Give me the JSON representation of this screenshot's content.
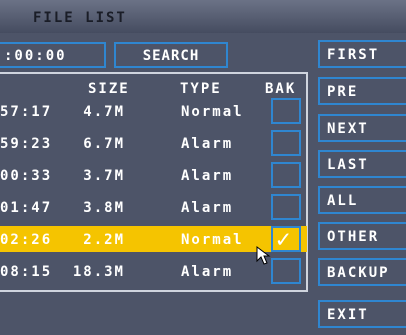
{
  "window": {
    "title": "FILE LIST"
  },
  "search": {
    "time_value": ":00:00",
    "button_label": "SEARCH"
  },
  "table": {
    "headers": {
      "size": "SIZE",
      "type": "TYPE",
      "bak": "BAK"
    },
    "rows": [
      {
        "time": "57:17",
        "size": "4.7M",
        "type": "Normal",
        "bak_checked": false,
        "selected": false
      },
      {
        "time": "59:23",
        "size": "6.7M",
        "type": "Alarm",
        "bak_checked": false,
        "selected": false
      },
      {
        "time": "00:33",
        "size": "3.7M",
        "type": "Alarm",
        "bak_checked": false,
        "selected": false
      },
      {
        "time": "01:47",
        "size": "3.8M",
        "type": "Alarm",
        "bak_checked": false,
        "selected": false
      },
      {
        "time": "02:26",
        "size": "2.2M",
        "type": "Normal",
        "bak_checked": true,
        "selected": true
      },
      {
        "time": "08:15",
        "size": "18.3M",
        "type": "Alarm",
        "bak_checked": false,
        "selected": false
      }
    ],
    "check_glyph": "✓"
  },
  "side_buttons": [
    "FIRST",
    "PRE",
    "NEXT",
    "LAST",
    "ALL",
    "OTHER",
    "BACKUP",
    "EXIT"
  ],
  "colors": {
    "background": "#4d5468",
    "border_blue": "#2f86d0",
    "selection": "#f5c400",
    "text": "#ffffff"
  }
}
